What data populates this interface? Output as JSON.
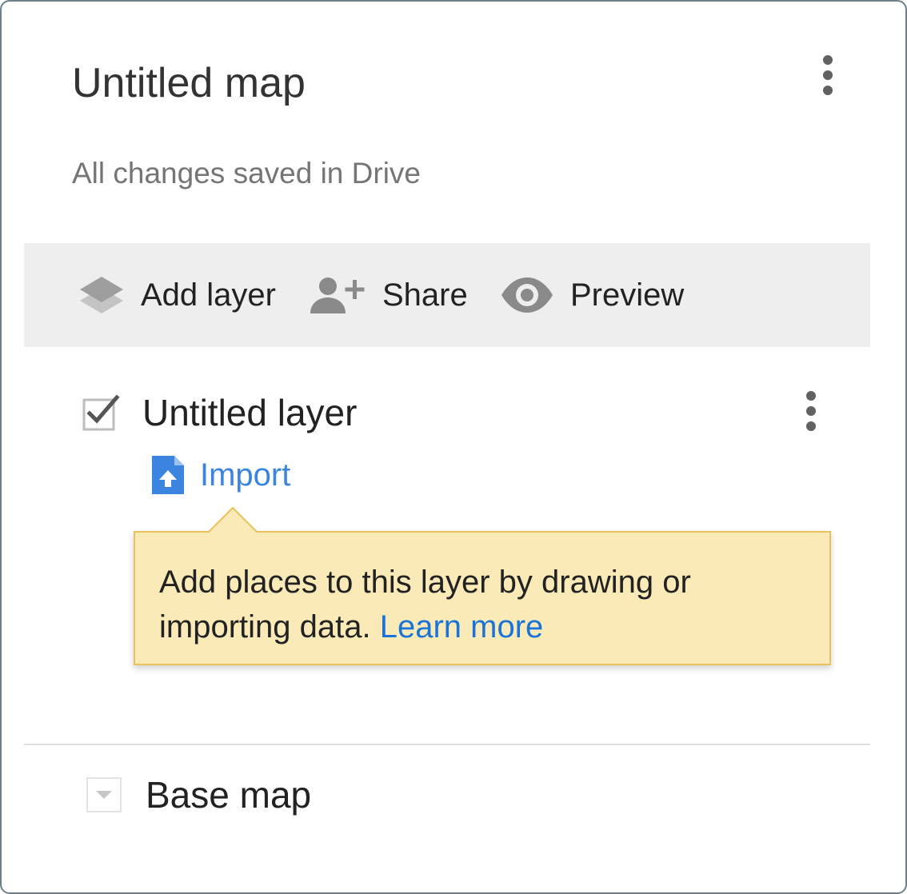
{
  "header": {
    "title": "Untitled map",
    "status": "All changes saved in Drive"
  },
  "toolbar": {
    "add_layer_label": "Add layer",
    "share_label": "Share",
    "preview_label": "Preview"
  },
  "layer": {
    "name": "Untitled layer",
    "checked": true,
    "import_label": "Import"
  },
  "tooltip": {
    "text": "Add places to this layer by drawing or importing data.",
    "link": "Learn more"
  },
  "base_map": {
    "label": "Base map"
  },
  "icons": {
    "header_menu": "more-vert-icon",
    "add_layer": "layers-icon",
    "share": "person-add-icon",
    "preview": "eye-icon",
    "layer_checkbox": "checkbox-checked-icon",
    "layer_menu": "more-vert-icon",
    "import": "file-upload-icon",
    "base_map_toggle": "caret-down-icon"
  },
  "colors": {
    "panel_border": "#6e8087",
    "toolbar_bg": "#eeeeee",
    "link_blue": "#1a73d9",
    "import_blue": "#3b84e0",
    "tooltip_bg": "#faeab8",
    "tooltip_border": "#e8c15a"
  }
}
